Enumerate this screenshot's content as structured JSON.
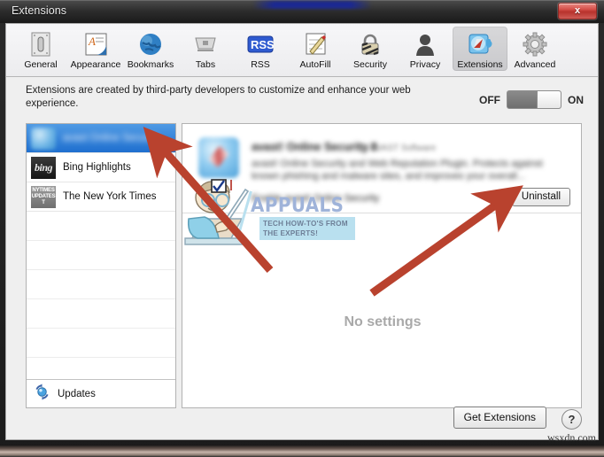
{
  "window": {
    "title": "Extensions",
    "close_label": "x"
  },
  "toolbar": {
    "items": [
      {
        "label": "General",
        "icon": "general-icon",
        "selected": false
      },
      {
        "label": "Appearance",
        "icon": "appearance-icon",
        "selected": false
      },
      {
        "label": "Bookmarks",
        "icon": "bookmarks-icon",
        "selected": false
      },
      {
        "label": "Tabs",
        "icon": "tabs-icon",
        "selected": false
      },
      {
        "label": "RSS",
        "icon": "rss-icon",
        "selected": false
      },
      {
        "label": "AutoFill",
        "icon": "autofill-icon",
        "selected": false
      },
      {
        "label": "Security",
        "icon": "security-icon",
        "selected": false
      },
      {
        "label": "Privacy",
        "icon": "privacy-icon",
        "selected": false
      },
      {
        "label": "Extensions",
        "icon": "extensions-icon",
        "selected": true
      },
      {
        "label": "Advanced",
        "icon": "advanced-icon",
        "selected": false
      }
    ]
  },
  "description": "Extensions are created by third-party developers to customize and enhance your web experience.",
  "toggle": {
    "off_label": "OFF",
    "on_label": "ON",
    "state": "ON"
  },
  "sidebar": {
    "items": [
      {
        "name": "avast Online Security",
        "icon": "safari-extension-icon",
        "selected": true,
        "blurred": true
      },
      {
        "name": "Bing Highlights",
        "icon": "bing-icon",
        "selected": false,
        "blurred": false
      },
      {
        "name": "The New York Times",
        "icon": "nytimes-icon",
        "selected": false,
        "blurred": false
      }
    ],
    "bing_glyph": "bing",
    "nyt_glyph_line1": "NYTIMES",
    "nyt_glyph_line2": "UPDATES",
    "nyt_glyph_line3": "T",
    "updates_label": "Updates",
    "updates_icon": "refresh-icon"
  },
  "detail": {
    "extension_title": "avast! Online Security 8",
    "extension_version": "by AVAST Software",
    "extension_description": "avast! Online Security and Web Reputation Plugin. Protects against known phishing and malware sites, and improves your overall...",
    "enable_checkbox_label": "Enable avast! Online Security",
    "uninstall_label": "Uninstall",
    "no_settings_label": "No settings"
  },
  "watermark": {
    "brand": "APPUALS",
    "tagline_line1": "TECH HOW-TO'S FROM",
    "tagline_line2": "THE EXPERTS!"
  },
  "footer": {
    "get_extensions_label": "Get Extensions",
    "help_label": "?"
  },
  "site_watermark": "wsxdn.com",
  "colors": {
    "selection_blue": "#1f6fcf",
    "arrow_red": "#b9422e",
    "accent_tagline": "#b9e0ef"
  }
}
